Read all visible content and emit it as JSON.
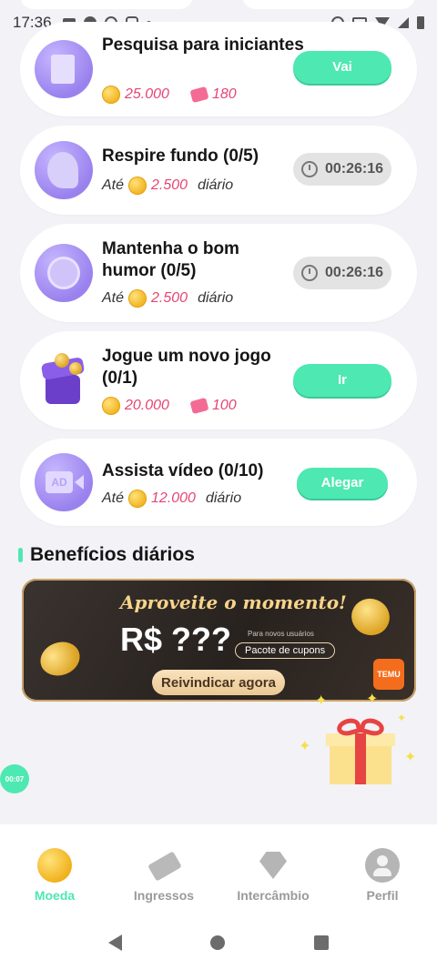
{
  "status_bar": {
    "time": "17:36"
  },
  "tasks": [
    {
      "title": "Pesquisa para iniciantes",
      "coins": "25.000",
      "tickets": "180",
      "action": "Vai",
      "action_type": "button"
    },
    {
      "title": "Respire fundo (0/5)",
      "prefix": "Até",
      "coins": "2.500",
      "suffix": "diário",
      "timer": "00:26:16",
      "action_type": "timer"
    },
    {
      "title": "Mantenha o bom humor (0/5)",
      "prefix": "Até",
      "coins": "2.500",
      "suffix": "diário",
      "timer": "00:26:16",
      "action_type": "timer"
    },
    {
      "title": "Jogue um novo jogo (0/1)",
      "coins": "20.000",
      "tickets": "100",
      "action": "Ir",
      "action_type": "button"
    },
    {
      "title": "Assista vídeo (0/10)",
      "prefix": "Até",
      "coins": "12.000",
      "suffix": "diário",
      "action": "Alegar",
      "action_type": "button"
    }
  ],
  "daily_benefits": {
    "title": "Benefícios diários",
    "banner": {
      "headline": "Aproveite o momento!",
      "price": "R$ ???",
      "note": "Para novos usuários",
      "coupon": "Pacote de cupons",
      "cta": "Reivindicar agora",
      "brand": "TEMU"
    }
  },
  "floating_timer": "00:07",
  "nav": [
    {
      "label": "Moeda",
      "icon": "coin-icon",
      "active": true
    },
    {
      "label": "Ingressos",
      "icon": "ticket-icon",
      "active": false
    },
    {
      "label": "Intercâmbio",
      "icon": "diamond-icon",
      "active": false
    },
    {
      "label": "Perfil",
      "icon": "profile-icon",
      "active": false
    }
  ],
  "colors": {
    "accent": "#4ee8b2",
    "pink": "#e54575",
    "background": "#f3f2f7"
  }
}
